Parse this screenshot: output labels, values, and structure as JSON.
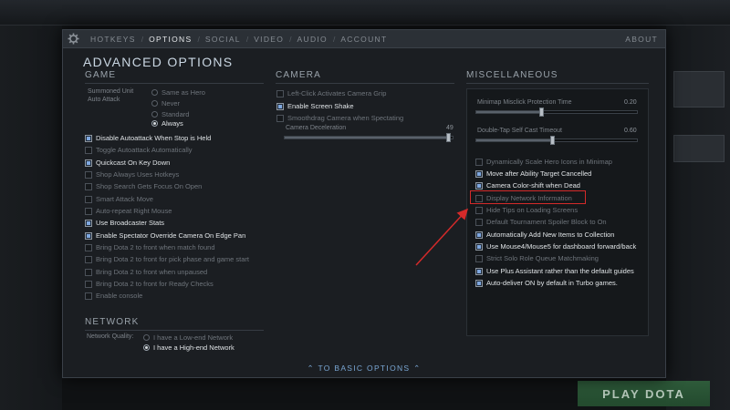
{
  "tabs": [
    {
      "label": "HOTKEYS",
      "active": false
    },
    {
      "label": "OPTIONS",
      "active": true
    },
    {
      "label": "SOCIAL",
      "active": false
    },
    {
      "label": "VIDEO",
      "active": false
    },
    {
      "label": "AUDIO",
      "active": false
    },
    {
      "label": "ACCOUNT",
      "active": false
    }
  ],
  "tab_separator": "/",
  "about_label": "ABOUT",
  "title": "ADVANCED OPTIONS",
  "game": {
    "heading": "GAME",
    "summoned_label_1": "Summoned Unit",
    "summoned_label_2": "Auto Attack",
    "summoned_options": [
      "Same as Hero",
      "Never",
      "Standard",
      "Always"
    ],
    "summoned_selected": 3,
    "options": [
      {
        "label": "Disable Autoattack When Stop is Held",
        "checked": true
      },
      {
        "label": "Toggle Autoattack Automatically",
        "checked": false
      },
      {
        "label": "Quickcast On Key Down",
        "checked": true
      },
      {
        "label": "Shop Always Uses Hotkeys",
        "checked": false
      },
      {
        "label": "Shop Search Gets Focus On Open",
        "checked": false
      },
      {
        "label": "Smart Attack Move",
        "checked": false
      },
      {
        "label": "Auto-repeat Right Mouse",
        "checked": false
      },
      {
        "label": "Use Broadcaster Stats",
        "checked": true
      },
      {
        "label": "Enable Spectator Override Camera On Edge Pan",
        "checked": true
      },
      {
        "label": "Bring Dota 2 to front when match found",
        "checked": false
      },
      {
        "label": "Bring Dota 2 to front for pick phase and game start",
        "checked": false
      },
      {
        "label": "Bring Dota 2 to front when unpaused",
        "checked": false
      },
      {
        "label": "Bring Dota 2 to front for Ready Checks",
        "checked": false
      },
      {
        "label": "Enable console",
        "checked": false
      }
    ]
  },
  "network": {
    "heading": "NETWORK",
    "quality_label": "Network Quality:",
    "options": [
      "I have a Low-end Network",
      "I have a High-end Network"
    ],
    "selected": 1
  },
  "camera": {
    "heading": "CAMERA",
    "options": [
      {
        "label": "Left-Click Activates Camera Grip",
        "checked": false
      },
      {
        "label": "Enable Screen Shake",
        "checked": true
      },
      {
        "label": "Smoothdrag Camera when Spectating",
        "checked": false
      }
    ],
    "deceleration_label": "Camera Deceleration",
    "deceleration_value": "49",
    "deceleration_fraction": 0.98
  },
  "misc": {
    "heading": "MISCELLANEOUS",
    "minimap_label": "Minimap Misclick Protection Time",
    "minimap_value": "0.20",
    "minimap_fraction": 0.41,
    "doubletap_label": "Double-Tap Self Cast Timeout",
    "doubletap_value": "0.60",
    "doubletap_fraction": 0.48,
    "options": [
      {
        "label": "Dynamically Scale Hero Icons in Minimap",
        "checked": false
      },
      {
        "label": "Move after Ability Target Cancelled",
        "checked": true
      },
      {
        "label": "Camera Color-shift when Dead",
        "checked": true
      },
      {
        "label": "Display Network Information",
        "checked": false
      },
      {
        "label": "Hide Tips on Loading Screens",
        "checked": false
      },
      {
        "label": "Default Tournament Spoiler Block to On",
        "checked": false
      },
      {
        "label": "Automatically Add New Items to Collection",
        "checked": true
      },
      {
        "label": "Use Mouse4/Mouse5 for dashboard forward/back",
        "checked": true
      },
      {
        "label": "Strict Solo Role Queue Matchmaking",
        "checked": false
      },
      {
        "label": "Use Plus Assistant rather than the default guides",
        "checked": true
      },
      {
        "label": "Auto-deliver ON by default in Turbo games.",
        "checked": true
      }
    ]
  },
  "highlight_color": "#d42a2a",
  "accent_color": "#7aa7d4",
  "to_basic_label": "TO BASIC OPTIONS",
  "background": {
    "play_label": "PLAY DOTA"
  }
}
